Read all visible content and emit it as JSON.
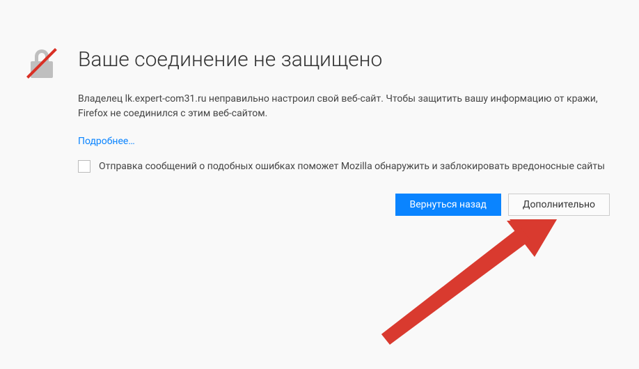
{
  "page": {
    "title": "Ваше соединение не защищено",
    "description": "Владелец lk.expert-com31.ru неправильно настроил свой веб-сайт. Чтобы защитить вашу информацию от кражи, Firefox не соединился с этим веб-сайтом.",
    "learn_more": "Подробнее…",
    "checkbox_label": "Отправка сообщений о подобных ошибках поможет Mozilla обнаружить и заблокировать вредоносные сайты"
  },
  "buttons": {
    "go_back": "Вернуться назад",
    "advanced": "Дополнительно"
  }
}
